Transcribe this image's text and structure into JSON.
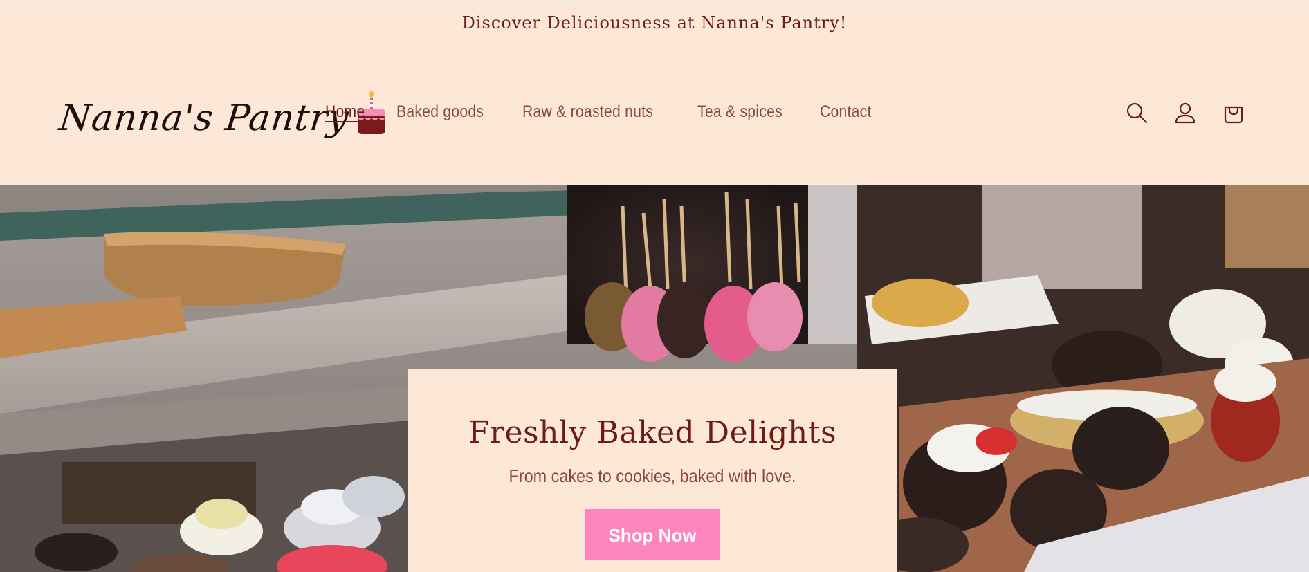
{
  "announcement": {
    "text": "Discover Deliciousness at Nanna's Pantry!"
  },
  "brand": {
    "logo_text": "Nanna's Pantry"
  },
  "nav": {
    "items": [
      {
        "label": "Home",
        "active": true
      },
      {
        "label": "Baked goods",
        "active": false
      },
      {
        "label": "Raw & roasted nuts",
        "active": false
      },
      {
        "label": "Tea & spices",
        "active": false
      },
      {
        "label": "Contact",
        "active": false
      }
    ]
  },
  "header_icons": [
    "search-icon",
    "account-icon",
    "cart-icon"
  ],
  "hero": {
    "title": "Freshly Baked Delights",
    "subtitle": "From cakes to cookies, baked with love.",
    "button_label": "Shop Now"
  },
  "colors": {
    "background": "#fde8d8",
    "brand_maroon": "#6e1c12",
    "nav_text": "#8a4a3a",
    "button_pink": "#ff85c0"
  }
}
